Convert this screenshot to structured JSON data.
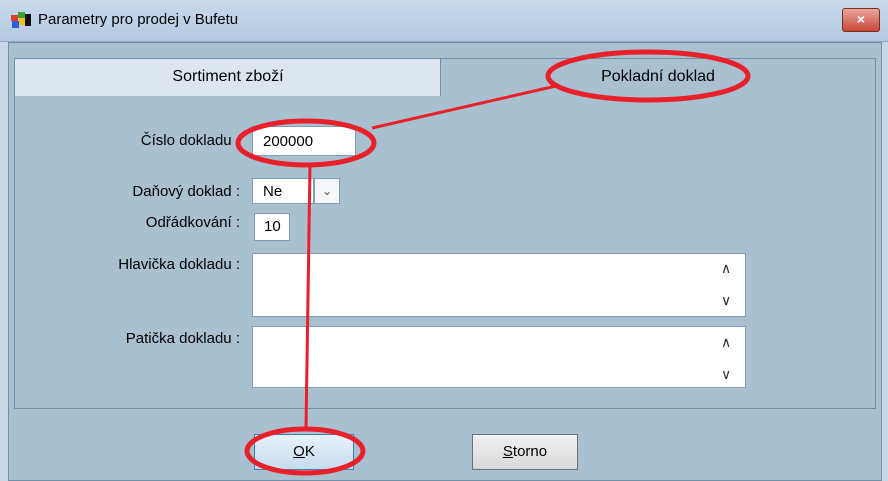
{
  "window": {
    "title": "Parametry pro prodej v Bufetu",
    "close_label": "×"
  },
  "tabs": [
    {
      "label": "Sortiment zboží"
    },
    {
      "label": "Pokladní doklad"
    }
  ],
  "form": {
    "cislo_label": "Číslo dokladu :",
    "cislo_value": "200000",
    "danovy_label": "Daňový doklad :",
    "danovy_value": "Ne",
    "odradkovani_label": "Odřádkování :",
    "odradkovani_value": "10",
    "hlavicka_label": "Hlavička dokladu :",
    "paticka_label": "Patička dokladu :"
  },
  "buttons": {
    "ok_mnemonic": "O",
    "ok_rest": "K",
    "storno_mnemonic": "S",
    "storno_rest": "torno"
  },
  "icons": {
    "app": "app-window-icon",
    "select_arrow": "chevron-down-icon",
    "scroll_up": "chevron-up-icon",
    "scroll_down": "chevron-down-icon"
  },
  "colors": {
    "annotation": "#e8202a",
    "panel": "#a9c0d1"
  }
}
